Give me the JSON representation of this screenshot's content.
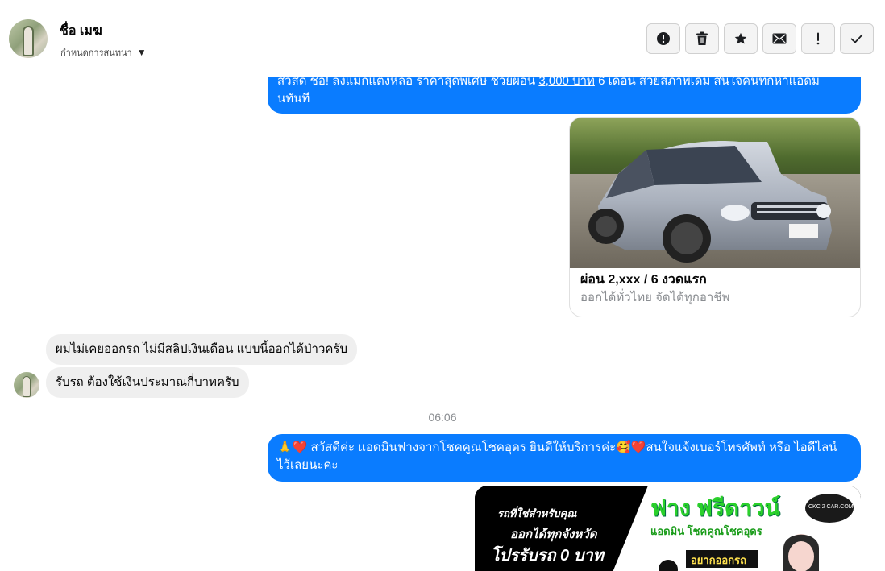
{
  "header": {
    "contact_name": "ชื่อ เมฆ",
    "subtitle": "กำหนดการสนทนา",
    "actions": [
      {
        "icon": "alert-circle-icon",
        "label": "report"
      },
      {
        "icon": "trash-icon",
        "label": "delete"
      },
      {
        "icon": "star-icon",
        "label": "star"
      },
      {
        "icon": "envelope-icon",
        "label": "mark-unread"
      },
      {
        "icon": "exclamation-icon",
        "label": "spam"
      },
      {
        "icon": "check-icon",
        "label": "done"
      }
    ]
  },
  "messages": {
    "out1": {
      "line1_pre": "สวัสดี ชอ! ลงแมกแตงหลอ ราคาสุดพเศษ ชวยผอน ",
      "line1_link": "3,000 บาท",
      "line1_post": " 6 เดอน สวยสภาพเดม สนใจคนทกหาแอดม",
      "line2": "นทันที"
    },
    "card": {
      "title": "ผ่อน 2,xxx / 6 งวดแรก",
      "subtitle": "ออกได้ทั่วไทย จัดได้ทุกอาชีพ"
    },
    "in1": "ผมไม่เคยออกรถ  ไม่มีสลิปเงินเดือน  แบบนี้ออกได้ป่าวครับ",
    "in2": "รับรถ ต้องใช้เงินประมาณกี่บาทครับ",
    "timestamp": "06:06",
    "out2": {
      "line1": "🙏❤️ สวัสดีค่ะ แอดมินฟางจากโชคคูณโชคอุดร ยินดีให้บริการค่ะ🥰❤️สนใจแจ้งเบอร์โทรศัพท์ หรือ ไอดีไลน์",
      "line2": "ไว้เลยนะคะ"
    },
    "promo": {
      "left1": "รถที่ใช่สำหรับคุณ",
      "left2": "ออกได้ทุกจังหวัด",
      "left3": "โปรรับรถ 0 บาท",
      "brand": "ฟาง ฟรีดาวน์",
      "sub": "แอดมิน โชคคูณโชคอุดร",
      "tag": "อยากออกรถ",
      "logo": "CKC 2 CAR.COM"
    }
  },
  "colors": {
    "outgoing_bubble": "#0a7cff",
    "incoming_bubble": "#efefef",
    "promo_green": "#2bd12b"
  }
}
